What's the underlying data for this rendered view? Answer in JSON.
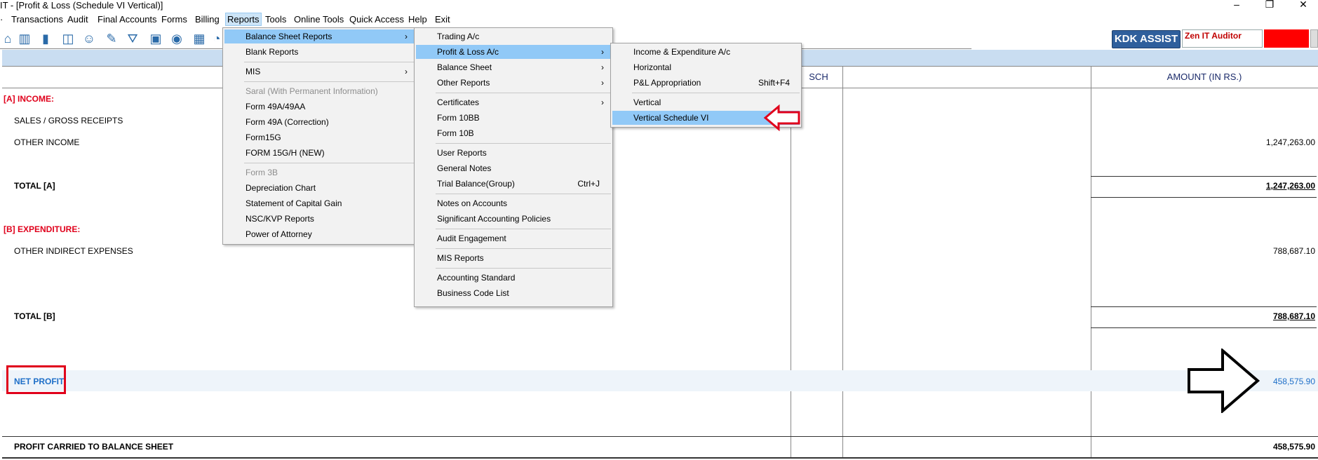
{
  "window": {
    "title": "IT - [Profit & Loss (Schedule VI Vertical)]",
    "min": "–",
    "restore": "❐",
    "close": "✕"
  },
  "menubar": [
    "Transactions",
    "Audit",
    "Final Accounts",
    "Forms",
    "Billing",
    "Reports",
    "Tools",
    "Online Tools",
    "Quick Access",
    "Help",
    "Exit"
  ],
  "toolbar_icons": [
    "home-icon",
    "building-icon",
    "bar-chart-icon",
    "gift-icon",
    "users-icon",
    "filter-icon",
    "pin-icon",
    "funnel-icon",
    "tax-icon",
    "speed-icon",
    "calculator-icon"
  ],
  "kdk_label": "KDK ASSIST",
  "zen_label": "Zen IT Auditor",
  "table": {
    "sch_header": "SCH",
    "amount_header": "AMOUNT (IN RS.)",
    "income_head": "[A] INCOME:",
    "sales": "SALES / GROSS RECEIPTS",
    "other_income": "OTHER INCOME",
    "other_income_amt": "1,247,263.00",
    "total_a": "TOTAL [A]",
    "total_a_amt": "1,247,263.00",
    "exp_head": "[B] EXPENDITURE:",
    "other_exp": "OTHER INDIRECT EXPENSES",
    "other_exp_amt": "788,687.10",
    "total_b": "TOTAL [B]",
    "total_b_amt": "788,687.10",
    "net_profit": "NET PROFIT",
    "net_profit_amt": "458,575.90",
    "carried": "PROFIT CARRIED TO BALANCE SHEET",
    "carried_amt": "458,575.90"
  },
  "reports_menu": [
    {
      "label": "Balance Sheet Reports",
      "submenu": true,
      "selected": true
    },
    {
      "label": "Blank Reports"
    },
    {
      "label": "MIS",
      "submenu": true
    },
    {
      "label": "Saral (With Permanent Information)",
      "disabled": true
    },
    {
      "label": "Form 49A/49AA"
    },
    {
      "label": "Form 49A (Correction)"
    },
    {
      "label": "Form15G"
    },
    {
      "label": "FORM 15G/H (NEW)"
    },
    {
      "label": "Form 3B",
      "disabled": true
    },
    {
      "label": "Depreciation Chart"
    },
    {
      "label": "Statement of Capital Gain"
    },
    {
      "label": "NSC/KVP Reports"
    },
    {
      "label": "Power of Attorney"
    }
  ],
  "bs_menu": [
    {
      "label": "Trading A/c"
    },
    {
      "label": "Profit & Loss A/c",
      "submenu": true,
      "selected": true
    },
    {
      "label": "Balance Sheet",
      "submenu": true
    },
    {
      "label": "Other Reports",
      "submenu": true
    },
    {
      "label": "Certificates",
      "submenu": true
    },
    {
      "label": "Form 10BB"
    },
    {
      "label": "Form 10B"
    },
    {
      "label": "User Reports"
    },
    {
      "label": "General Notes"
    },
    {
      "label": "Trial Balance(Group)",
      "shortcut": "Ctrl+J"
    },
    {
      "label": "Notes on Accounts"
    },
    {
      "label": "Significant Accounting Policies"
    },
    {
      "label": "Audit Engagement"
    },
    {
      "label": "MIS Reports"
    },
    {
      "label": "Accounting Standard"
    },
    {
      "label": "Business Code List"
    }
  ],
  "pl_menu": [
    {
      "label": "Income & Expenditure A/c"
    },
    {
      "label": "Horizontal"
    },
    {
      "label": "P&L Appropriation",
      "shortcut": "Shift+F4"
    },
    {
      "label": "Vertical"
    },
    {
      "label": "Vertical Schedule VI",
      "selected": true
    }
  ]
}
